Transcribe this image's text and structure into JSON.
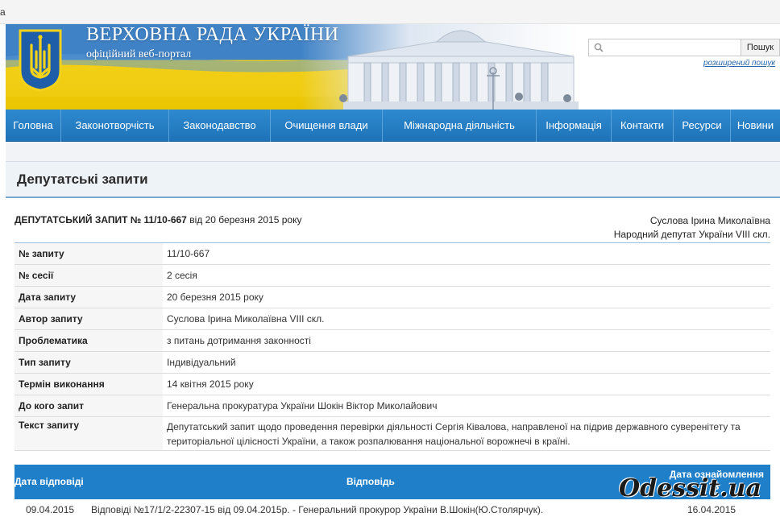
{
  "top_strip": {
    "text": "a"
  },
  "header": {
    "title": "ВЕРХОВНА РАДА УКРАЇНИ",
    "subtitle": "офіційний веб-портал",
    "search": {
      "placeholder": "",
      "button_label": "Пошук",
      "advanced_link": "розширений пошук"
    }
  },
  "nav": {
    "items": [
      {
        "label": "Головна"
      },
      {
        "label": "Законотворчість"
      },
      {
        "label": "Законодавство"
      },
      {
        "label": "Очищення влади"
      },
      {
        "label": "Міжнародна діяльність"
      },
      {
        "label": "Інформація"
      },
      {
        "label": "Контакти"
      },
      {
        "label": "Ресурси"
      },
      {
        "label": "Новини"
      }
    ]
  },
  "page": {
    "title": "Депутатські запити"
  },
  "request": {
    "heading_bold": "ДЕПУТАТСЬКИЙ ЗАПИТ № 11/10-667",
    "heading_rest": " від 20 березня 2015 року",
    "author_name": "Суслова Ірина Миколаївна",
    "author_role": "Народний депутат України VIII скл.",
    "fields": [
      {
        "key": "№ запиту",
        "value": "11/10-667"
      },
      {
        "key": "№ сесії",
        "value": "2 сесія"
      },
      {
        "key": "Дата запиту",
        "value": "20 березня 2015 року"
      },
      {
        "key": "Автор запиту",
        "value": "Суслова Ірина Миколаївна VIII скл."
      },
      {
        "key": "Проблематика",
        "value": "з питань дотримання законності"
      },
      {
        "key": "Тип запиту",
        "value": "Індивідуальний"
      },
      {
        "key": "Термін виконання",
        "value": "14 квітня 2015 року"
      },
      {
        "key": "До кого запит",
        "value": "Генеральна прокуратура України Шокін Віктор Миколайович"
      },
      {
        "key": "Текст запиту",
        "value": "Депутатський запит щодо проведення перевірки діяльності Сергія Ківалова, направленої на підрив державного суверенітету та територіальної цілісності України, а також розпалювання національної ворожнечі в країні."
      }
    ]
  },
  "answers": {
    "columns": [
      "Дата відповіді",
      "Відповідь",
      "Дата ознайомлення"
    ],
    "column3_line2": "з",
    "rows": [
      {
        "date": "09.04.2015",
        "text": "Відповіді №17/1/2-22307-15 від 09.04.2015р. - Генеральний прокурор України В.Шокін(Ю.Столярчук).",
        "ack_date": "16.04.2015"
      }
    ]
  },
  "watermark": {
    "text": "Odessit.ua"
  },
  "colors": {
    "nav_blue": "#1f73b8",
    "header_blue": "#1f7fc9",
    "flag_blue": "#3f82c6",
    "flag_yellow": "#f3d21b"
  }
}
